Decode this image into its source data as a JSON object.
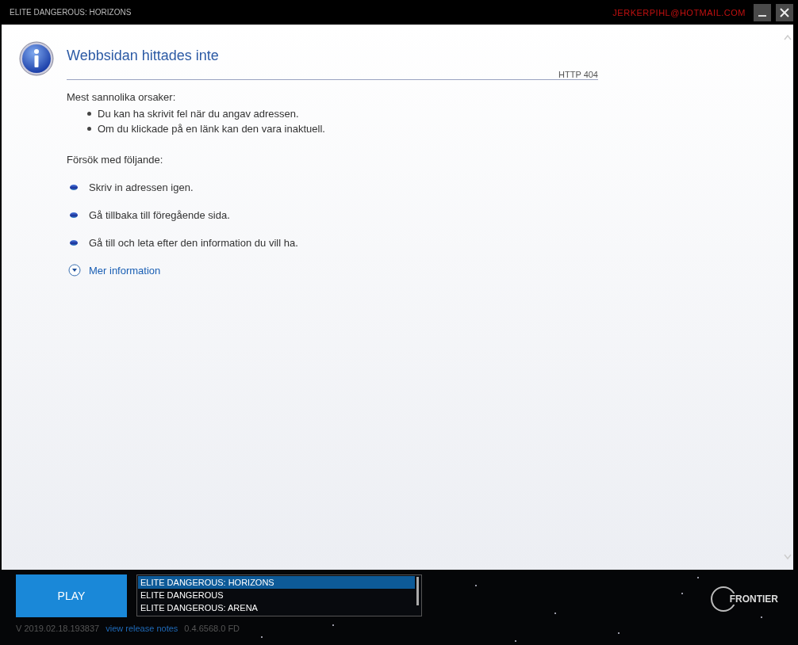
{
  "window": {
    "title": "ELITE DANGEROUS: HORIZONS",
    "account": "JERKERPIHL@HOTMAIL.COM"
  },
  "error_page": {
    "title": "Webbsidan hittades inte",
    "code": "HTTP 404",
    "causes_heading": "Mest sannolika orsaker:",
    "causes": [
      "Du kan ha skrivit fel när du angav adressen.",
      "Om du klickade på en länk kan den vara inaktuell."
    ],
    "try_heading": "Försök med följande:",
    "suggestions": [
      "Skriv in adressen igen.",
      "Gå tillbaka till föregående sida.",
      "Gå till  och leta efter den information du vill ha."
    ],
    "more_info": {
      "label": "Mer information",
      "expanded": false
    }
  },
  "launcher": {
    "play_button": "PLAY",
    "games": [
      {
        "name": "ELITE DANGEROUS: HORIZONS",
        "selected": true
      },
      {
        "name": "ELITE DANGEROUS",
        "selected": false
      },
      {
        "name": "ELITE DANGEROUS: ARENA",
        "selected": false
      }
    ],
    "version": "V 2019.02.18.193837",
    "release_notes_link": "view release notes",
    "build": "0.4.6568.0 FD",
    "logo": "FRONTIER"
  }
}
